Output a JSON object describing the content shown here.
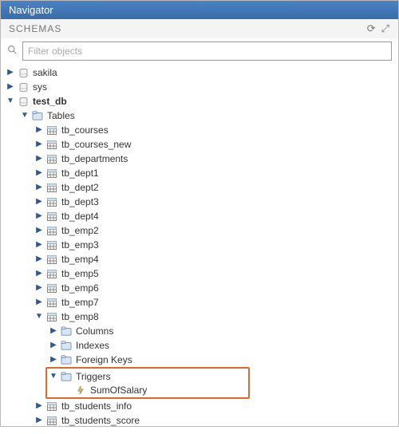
{
  "panel_title": "Navigator",
  "section_label": "SCHEMAS",
  "search_placeholder": "Filter objects",
  "header_icons": {
    "refresh": "⟳",
    "collapse": "⤢"
  },
  "schemas": [
    {
      "name": "sakila",
      "expanded": false
    },
    {
      "name": "sys",
      "expanded": false
    },
    {
      "name": "test_db",
      "expanded": true,
      "bold": true
    }
  ],
  "testdb": {
    "tables_label": "Tables",
    "tables": [
      "tb_courses",
      "tb_courses_new",
      "tb_departments",
      "tb_dept1",
      "tb_dept2",
      "tb_dept3",
      "tb_dept4",
      "tb_emp2",
      "tb_emp3",
      "tb_emp4",
      "tb_emp5",
      "tb_emp6",
      "tb_emp7"
    ],
    "expanded_table": "tb_emp8",
    "table_children": {
      "columns": "Columns",
      "indexes": "Indexes",
      "foreign_keys": "Foreign Keys",
      "triggers": "Triggers"
    },
    "triggers": [
      "SumOfSalary"
    ],
    "tables_after": [
      "tb_students_info",
      "tb_students_score"
    ]
  }
}
